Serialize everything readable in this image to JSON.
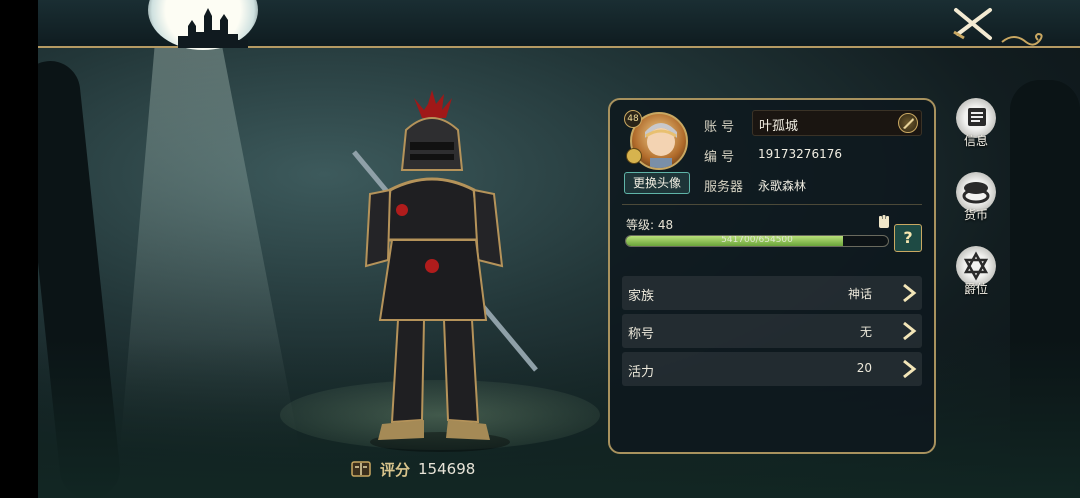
{
  "character": {
    "score_label": "评分",
    "score_value": "154698"
  },
  "profile": {
    "avatar_level": "48",
    "change_avatar_label": "更换头像",
    "account_label": "账  号",
    "account_value": "叶孤城",
    "id_label": "编  号",
    "id_value": "19173276176",
    "server_label": "服务器",
    "server_value": "永歌森林",
    "level_label": "等级:",
    "level_value": "48",
    "exp_text": "541700/654500",
    "exp_fraction": 0.83,
    "help_label": "?"
  },
  "rows": [
    {
      "label": "家族",
      "value": "神话"
    },
    {
      "label": "称号",
      "value": "无"
    },
    {
      "label": "活力",
      "value": "20"
    }
  ],
  "side_menu": [
    {
      "label": "信息",
      "icon": "info-card-icon"
    },
    {
      "label": "货币",
      "icon": "coins-icon"
    },
    {
      "label": "爵位",
      "icon": "star-badge-icon"
    }
  ],
  "colors": {
    "accent_gold": "#a8925e",
    "exp_green": "#8cc34f",
    "panel_bg": "#0e181e"
  }
}
